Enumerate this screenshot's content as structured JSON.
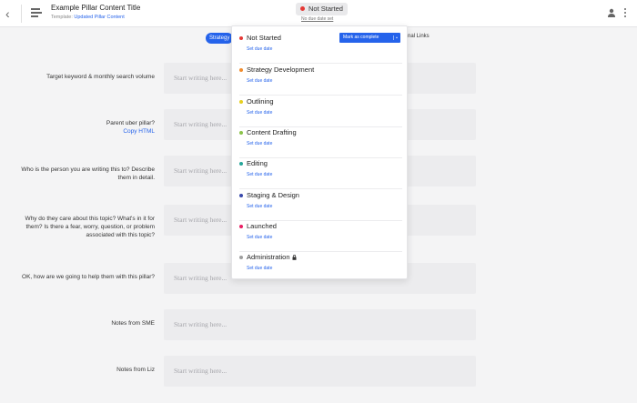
{
  "header": {
    "title": "Example Pillar Content Title",
    "template_prefix": "Template:",
    "template_name": "Updated Pillar Content",
    "status": "Not Started",
    "due_date": "No due date set"
  },
  "tabs": {
    "active": "Strategy",
    "links": "nal Links"
  },
  "rows": [
    {
      "label": "Target keyword & monthly search volume",
      "placeholder": "Start writing here..."
    },
    {
      "label": "Parent uber pillar?",
      "extra": "Copy HTML",
      "placeholder": "Start writing here..."
    },
    {
      "label": "Who is the person you are writing this to? Describe them in detail.",
      "placeholder": "Start writing here..."
    },
    {
      "label": "Why do they care about this topic? What's in it for them? Is there a fear, worry, question, or problem associated with this topic?",
      "placeholder": "Start writing here..."
    },
    {
      "label": "OK, how are we going to help them with this pillar?",
      "placeholder": "Start writing here..."
    },
    {
      "label": "Notes from SME",
      "placeholder": "Start writing here..."
    },
    {
      "label": "Notes from Liz",
      "placeholder": "Start writing here..."
    }
  ],
  "status_menu": {
    "mark_complete": "Mark as complete",
    "set_due": "Set due date",
    "items": [
      {
        "name": "Not Started",
        "color": "#e53935"
      },
      {
        "name": "Strategy Development",
        "color": "#f08c2e"
      },
      {
        "name": "Outlining",
        "color": "#e6cf1f"
      },
      {
        "name": "Content Drafting",
        "color": "#8bc34a"
      },
      {
        "name": "Editing",
        "color": "#26a69a"
      },
      {
        "name": "Staging & Design",
        "color": "#3949ab"
      },
      {
        "name": "Launched",
        "color": "#e91e63"
      },
      {
        "name": "Administration",
        "color": "#9e9e9e"
      }
    ]
  }
}
